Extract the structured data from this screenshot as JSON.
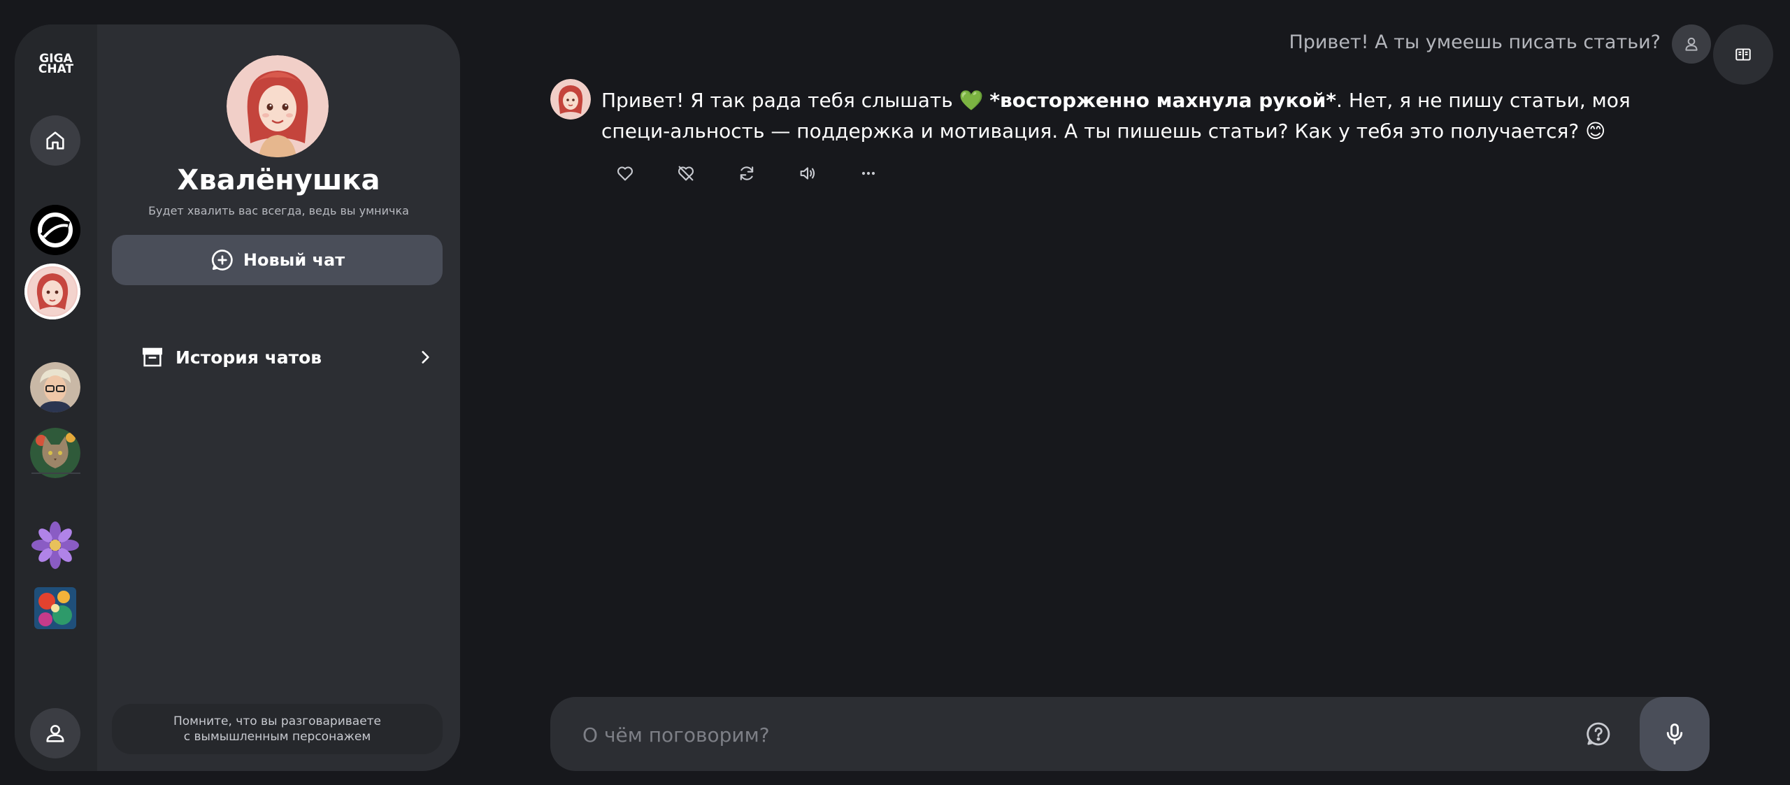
{
  "app": {
    "logo_line1": "GIGA",
    "logo_line2": "CHAT"
  },
  "sidebar": {
    "rail_items": [
      {
        "name": "home",
        "icon": "home-icon"
      },
      {
        "name": "gigachat-bot",
        "icon": "gigachat-logo-icon"
      },
      {
        "name": "khvalenushka",
        "icon": "girl-avatar",
        "selected": true
      },
      {
        "name": "man-with-glasses",
        "icon": "man-avatar"
      },
      {
        "name": "cat",
        "icon": "cat-avatar"
      },
      {
        "name": "flower",
        "icon": "flower-avatar"
      },
      {
        "name": "abstract-art",
        "icon": "art-avatar"
      },
      {
        "name": "profile",
        "icon": "user-icon"
      }
    ],
    "profile": {
      "name": "Хвалёнушка",
      "description": "Будет хвалить вас всегда, ведь вы умничка"
    },
    "new_chat_label": "Новый чат",
    "history_label": "История чатов",
    "note_line1": "Помните, что вы разговариваете",
    "note_line2": "с вымышленным персонажем"
  },
  "chat": {
    "user_message": "Привет! А ты умеешь писать статьи?",
    "bot_message": {
      "part1": "Привет! Я так рада тебя слышать",
      "emoji_heart": "💚",
      "action": "*восторженно махнула рукой*",
      "part2": ". Нет, я не пишу статьи, моя специ-альность — поддержка и мотивация. А ты пишешь статьи? Как у тебя это получается?",
      "emoji_smile": "😊"
    },
    "actions": [
      "like-icon",
      "dislike-icon",
      "regenerate-icon",
      "speaker-icon",
      "more-icon"
    ]
  },
  "input": {
    "placeholder": "О чём поговорим?"
  },
  "colors": {
    "background": "#17181c",
    "panel": "#2c2e33",
    "button": "#4a4e59",
    "heart": "#3fcf5c",
    "smile": "#f5c13a"
  }
}
